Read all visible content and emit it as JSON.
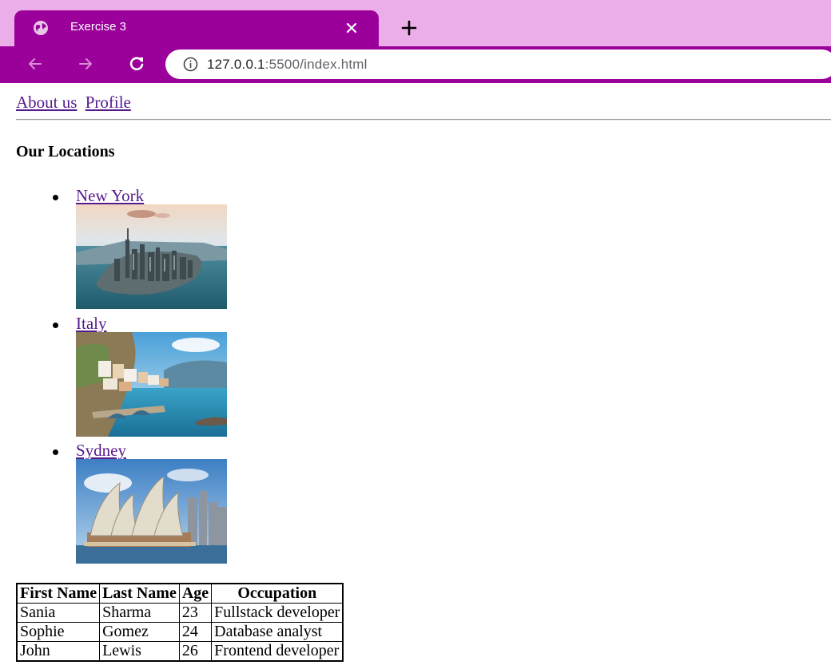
{
  "browser": {
    "tab_title": "Exercise 3",
    "url_host": "127.0.0.1",
    "url_rest": ":5500/index.html",
    "colors": {
      "tab_strip": "#ebaee8",
      "toolbar": "#9b009b"
    }
  },
  "page": {
    "nav_links": [
      "About us",
      "Profile"
    ],
    "heading": "Our Locations",
    "locations": [
      {
        "name": "New York",
        "image": "new-york-skyline-photo"
      },
      {
        "name": "Italy",
        "image": "italy-coastal-village-photo"
      },
      {
        "name": "Sydney",
        "image": "sydney-opera-house-photo"
      }
    ],
    "table": {
      "headers": [
        "First Name",
        "Last Name",
        "Age",
        "Occupation"
      ],
      "rows": [
        [
          "Sania",
          "Sharma",
          "23",
          "Fullstack developer"
        ],
        [
          "Sophie",
          "Gomez",
          "24",
          "Database analyst"
        ],
        [
          "John",
          "Lewis",
          "26",
          "Frontend developer"
        ]
      ]
    }
  }
}
